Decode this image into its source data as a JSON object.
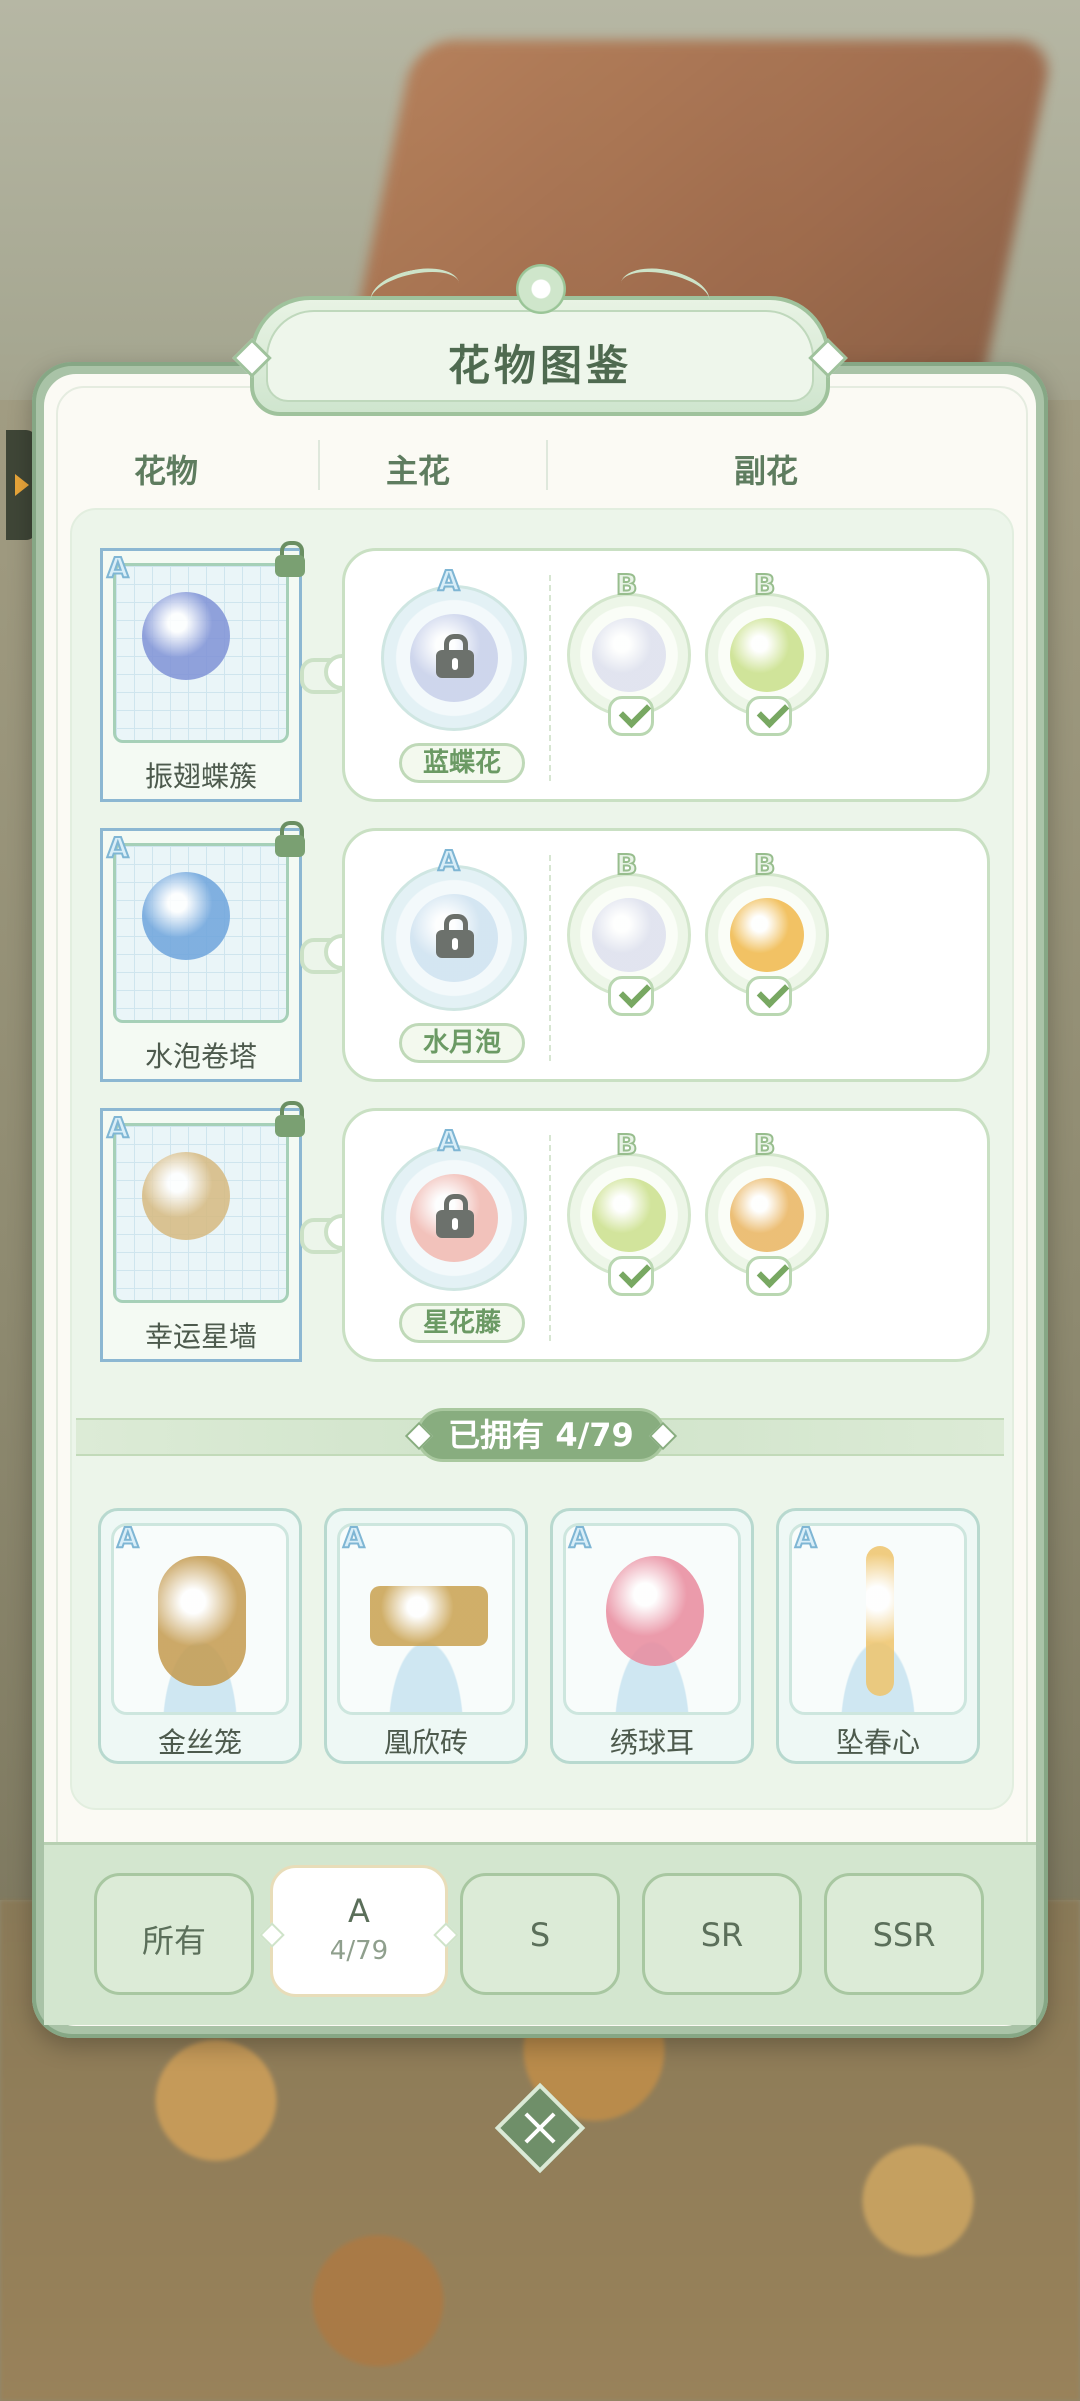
{
  "title": "花物图鉴",
  "columns": {
    "item": "花物",
    "main": "主花",
    "sub": "副花"
  },
  "grade_letters": {
    "A": "A",
    "B": "B"
  },
  "recipes": [
    {
      "result": {
        "name": "振翅蝶簇",
        "grade": "A",
        "locked": true,
        "color": "#7f92d6"
      },
      "main": {
        "name": "蓝蝶花",
        "grade": "A",
        "locked": true,
        "color": "#c8d0ea"
      },
      "subs": [
        {
          "grade": "B",
          "owned": true,
          "color": "#dde0ee"
        },
        {
          "grade": "B",
          "owned": true,
          "color": "#c9e08a"
        }
      ]
    },
    {
      "result": {
        "name": "水泡卷塔",
        "grade": "A",
        "locked": true,
        "color": "#6ea4dc"
      },
      "main": {
        "name": "水月泡",
        "grade": "A",
        "locked": true,
        "color": "#cfe2f0"
      },
      "subs": [
        {
          "grade": "B",
          "owned": true,
          "color": "#dde0ee"
        },
        {
          "grade": "B",
          "owned": true,
          "color": "#f0b84a"
        }
      ]
    },
    {
      "result": {
        "name": "幸运星墙",
        "grade": "A",
        "locked": true,
        "color": "#d6b980"
      },
      "main": {
        "name": "星花藤",
        "grade": "A",
        "locked": true,
        "color": "#f2b8b0"
      },
      "subs": [
        {
          "grade": "B",
          "owned": true,
          "color": "#cbe08c"
        },
        {
          "grade": "B",
          "owned": true,
          "color": "#eab460"
        }
      ]
    }
  ],
  "owned_banner": {
    "label": "已拥有 4/79"
  },
  "owned_items": [
    {
      "name": "金丝笼",
      "grade": "A",
      "color": "#c49a4e"
    },
    {
      "name": "凰欣砖",
      "grade": "A",
      "color": "#c9a14f"
    },
    {
      "name": "绣球耳",
      "grade": "A",
      "color": "#e98a9d"
    },
    {
      "name": "坠春心",
      "grade": "A",
      "color": "#efc46b"
    }
  ],
  "filters": [
    {
      "label": "所有",
      "active": false
    },
    {
      "label": "A",
      "sub": "4/79",
      "active": true
    },
    {
      "label": "S",
      "active": false
    },
    {
      "label": "SR",
      "active": false
    },
    {
      "label": "SSR",
      "active": false
    }
  ],
  "icons": {
    "close": "close-icon",
    "lock": "lock-icon",
    "check": "check-icon",
    "side_arrow": "arrow-right-icon"
  }
}
